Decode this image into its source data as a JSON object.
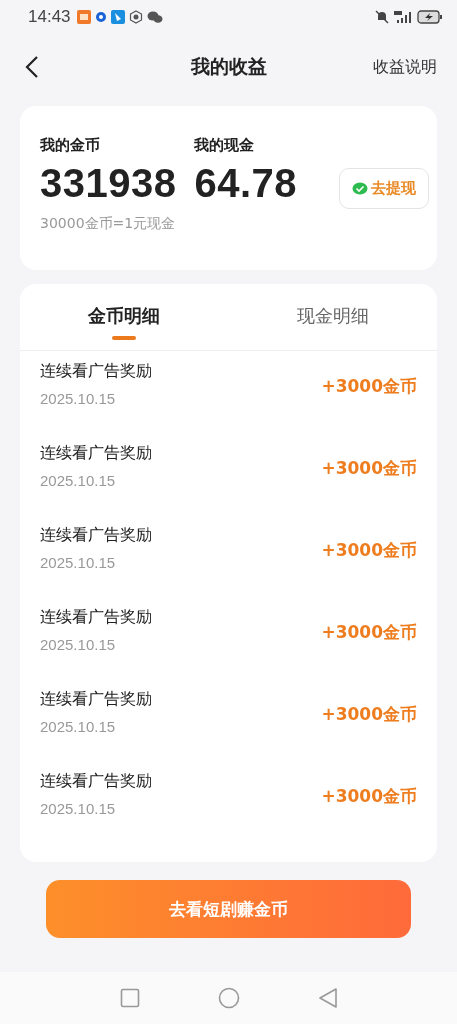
{
  "status_bar": {
    "time": "14:43"
  },
  "header": {
    "title": "我的收益",
    "action": "收益说明"
  },
  "balance": {
    "coins_label": "我的金币",
    "coins": "331938",
    "cash_label": "我的现金",
    "cash": "64.78",
    "rate": "30000金币=1元现金",
    "withdraw": "去提现"
  },
  "tabs": [
    {
      "label": "金币明细",
      "selected": true
    },
    {
      "label": "现金明细",
      "selected": false
    }
  ],
  "records": [
    {
      "title": "连续看广告奖励",
      "date": "2025.10.15",
      "amount": "+3000金币"
    },
    {
      "title": "连续看广告奖励",
      "date": "2025.10.15",
      "amount": "+3000金币"
    },
    {
      "title": "连续看广告奖励",
      "date": "2025.10.15",
      "amount": "+3000金币"
    },
    {
      "title": "连续看广告奖励",
      "date": "2025.10.15",
      "amount": "+3000金币"
    },
    {
      "title": "连续看广告奖励",
      "date": "2025.10.15",
      "amount": "+3000金币"
    },
    {
      "title": "连续看广告奖励",
      "date": "2025.10.15",
      "amount": "+3000金币"
    }
  ],
  "cta": "去看短剧赚金币"
}
